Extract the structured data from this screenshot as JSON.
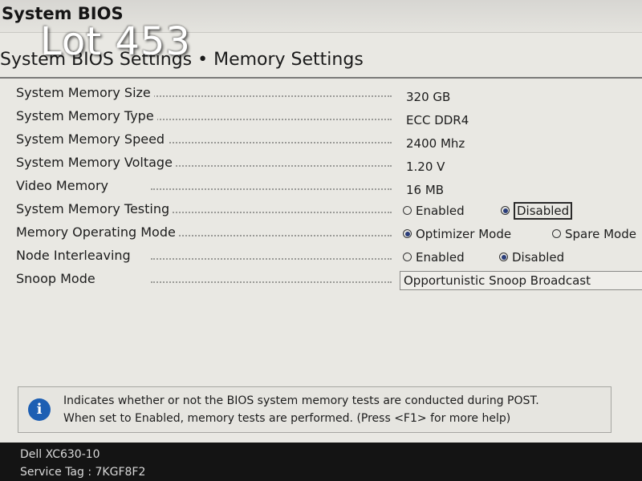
{
  "app_title": "System BIOS",
  "overlay_text": "Lot 453",
  "page_heading": "System BIOS Settings • Memory Settings",
  "settings": {
    "memory_size": {
      "label": "System Memory Size",
      "value": "320 GB"
    },
    "memory_type": {
      "label": "System Memory Type",
      "value": "ECC DDR4"
    },
    "memory_speed": {
      "label": "System Memory Speed",
      "value": "2400 Mhz"
    },
    "memory_voltage": {
      "label": "System Memory Voltage",
      "value": "1.20 V"
    },
    "video_memory": {
      "label": "Video Memory",
      "value": "16 MB"
    },
    "memory_testing": {
      "label": "System Memory Testing",
      "options": [
        "Enabled",
        "Disabled"
      ],
      "selected": "Disabled"
    },
    "operating_mode": {
      "label": "Memory Operating Mode",
      "options": [
        "Optimizer Mode",
        "Spare Mode"
      ],
      "selected": "Optimizer Mode"
    },
    "node_interleaving": {
      "label": "Node Interleaving",
      "options": [
        "Enabled",
        "Disabled"
      ],
      "selected": "Disabled"
    },
    "snoop_mode": {
      "label": "Snoop Mode",
      "value": "Opportunistic Snoop Broadcast"
    }
  },
  "help": {
    "line1": "Indicates whether or not the BIOS system memory tests are conducted during POST.",
    "line2": "When set to Enabled, memory tests are performed. (Press <F1> for more help)",
    "icon": "info-icon"
  },
  "footer": {
    "model": "Dell XC630-10",
    "service_tag": "Service Tag : 7KGF8F2"
  },
  "colors": {
    "background": "#e9e8e3",
    "footer_bg": "#141414",
    "info_icon": "#1d5fb3",
    "radio_selected": "#2a3d7a"
  }
}
